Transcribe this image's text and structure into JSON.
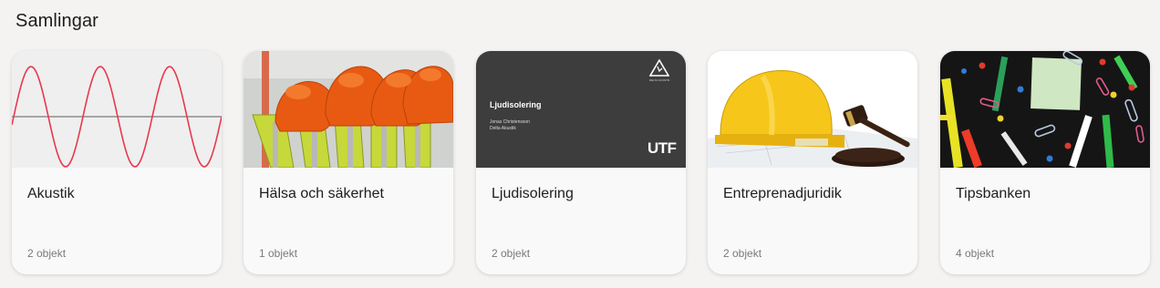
{
  "section": {
    "title": "Samlingar"
  },
  "collections": [
    {
      "title": "Akustik",
      "count": "2 objekt",
      "image": "sine-wave-graph"
    },
    {
      "title": "Hälsa och säkerhet",
      "count": "1 objekt",
      "image": "hard-hats-and-safety-vests"
    },
    {
      "title": "Ljudisolering",
      "count": "2 objekt",
      "image": "presentation-slide",
      "slide": {
        "title": "Ljudisolering",
        "author": "Jonas Christensson",
        "company": "Delta Akustik",
        "brand": "UTF",
        "logo_text": "DELTA AKUSTIK"
      }
    },
    {
      "title": "Entreprenadjuridik",
      "count": "2 objekt",
      "image": "hard-hat-and-gavel"
    },
    {
      "title": "Tipsbanken",
      "count": "4 objekt",
      "image": "office-supplies-on-blackboard"
    }
  ],
  "colors": {
    "background": "#f4f3f2",
    "card": "#f9f9f9",
    "wave": "#e8384f",
    "slide": "#3d3d3d"
  }
}
